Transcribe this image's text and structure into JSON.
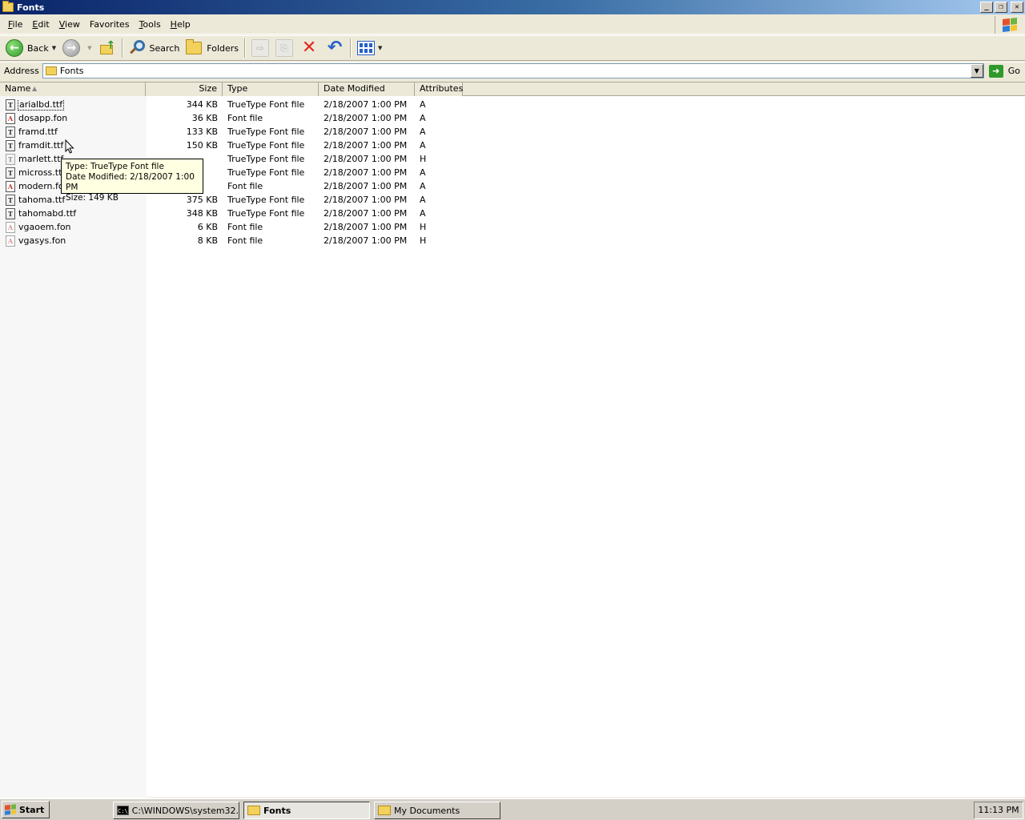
{
  "window": {
    "title": "Fonts"
  },
  "window_buttons": {
    "minimize": "_",
    "maximize": "❐",
    "close": "✕"
  },
  "menu": [
    {
      "underline": "F",
      "rest": "ile"
    },
    {
      "underline": "E",
      "rest": "dit"
    },
    {
      "underline": "V",
      "rest": "iew"
    },
    {
      "underline": "F",
      "rest": "avorites",
      "prefix": ""
    },
    {
      "underline": "T",
      "rest": "ools"
    },
    {
      "underline": "H",
      "rest": "elp"
    }
  ],
  "toolbar": {
    "back_label": "Back",
    "search_label": "Search",
    "folders_label": "Folders"
  },
  "address": {
    "label": "Address",
    "value": "Fonts",
    "go_label": "Go"
  },
  "columns": {
    "name": "Name",
    "size": "Size",
    "type": "Type",
    "date": "Date Modified",
    "attributes": "Attributes"
  },
  "files": [
    {
      "name": "arialbd.ttf",
      "size": "344 KB",
      "type": "TrueType Font file",
      "date": "2/18/2007 1:00 PM",
      "attr": "A",
      "icon": "truetype-icon"
    },
    {
      "name": "dosapp.fon",
      "size": "36 KB",
      "type": "Font file",
      "date": "2/18/2007 1:00 PM",
      "attr": "A",
      "icon": "font-file-icon"
    },
    {
      "name": "framd.ttf",
      "size": "133 KB",
      "type": "TrueType Font file",
      "date": "2/18/2007 1:00 PM",
      "attr": "A",
      "icon": "truetype-icon"
    },
    {
      "name": "framdit.ttf",
      "size": "150 KB",
      "type": "TrueType Font file",
      "date": "2/18/2007 1:00 PM",
      "attr": "A",
      "icon": "truetype-icon"
    },
    {
      "name": "marlett.ttf",
      "size": "",
      "type": "TrueType Font file",
      "date": "2/18/2007 1:00 PM",
      "attr": "H",
      "icon": "truetype-icon"
    },
    {
      "name": "micross.ttf",
      "size": "",
      "type": "TrueType Font file",
      "date": "2/18/2007 1:00 PM",
      "attr": "A",
      "icon": "truetype-icon"
    },
    {
      "name": "modern.fon",
      "size": "",
      "type": "Font file",
      "date": "2/18/2007 1:00 PM",
      "attr": "A",
      "icon": "font-file-icon"
    },
    {
      "name": "tahoma.ttf",
      "size": "375 KB",
      "type": "TrueType Font file",
      "date": "2/18/2007 1:00 PM",
      "attr": "A",
      "icon": "truetype-icon"
    },
    {
      "name": "tahomabd.ttf",
      "size": "348 KB",
      "type": "TrueType Font file",
      "date": "2/18/2007 1:00 PM",
      "attr": "A",
      "icon": "truetype-icon"
    },
    {
      "name": "vgaoem.fon",
      "size": "6 KB",
      "type": "Font file",
      "date": "2/18/2007 1:00 PM",
      "attr": "H",
      "icon": "font-file-icon"
    },
    {
      "name": "vgasys.fon",
      "size": "8 KB",
      "type": "Font file",
      "date": "2/18/2007 1:00 PM",
      "attr": "H",
      "icon": "font-file-icon"
    }
  ],
  "tooltip": {
    "line1": "Type: TrueType Font file",
    "line2": "Date Modified: 2/18/2007 1:00 PM",
    "line3": "Size: 149 KB"
  },
  "taskbar": {
    "start_label": "Start",
    "tasks": [
      {
        "label": "C:\\WINDOWS\\system32...",
        "icon": "command-prompt-icon",
        "active": false
      },
      {
        "label": "Fonts",
        "icon": "folder-icon",
        "active": true
      },
      {
        "label": "My Documents",
        "icon": "folder-icon",
        "active": false
      }
    ],
    "clock": "11:13 PM"
  },
  "colors": {
    "title_gradient_start": "#0a246a",
    "title_gradient_end": "#a6caf0",
    "tooltip_bg": "#ffffe1",
    "chrome": "#ece9d8"
  }
}
